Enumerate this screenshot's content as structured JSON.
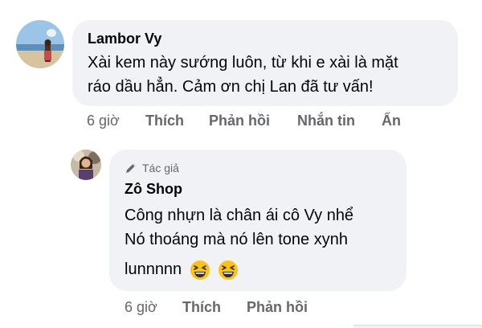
{
  "comment": {
    "author": "Lambor Vy",
    "text_lines": [
      "Xài kem này sướng luôn, từ khi e xài là mặt",
      "ráo dầu hẳn. Cảm ơn chị Lan đã tư vấn!"
    ],
    "time": "6 giờ",
    "actions": {
      "like": "Thích",
      "reply": "Phản hồi",
      "message": "Nhắn tin",
      "hide": "Ẩn"
    }
  },
  "reply": {
    "badge": "Tác giả",
    "author": "Zô Shop",
    "text_lines": [
      "Công nhựn là chân ái cô Vy nhể",
      "Nó  thoáng mà nó lên tone xynh",
      "lunnnnn"
    ],
    "emoji": [
      "grinning-squinting-face",
      "grinning-squinting-face"
    ],
    "time": "6 giờ",
    "actions": {
      "like": "Thích",
      "reply": "Phản hồi"
    }
  },
  "colors": {
    "bubble": "#f0f2f5",
    "meta_text": "#65676b",
    "text": "#050505"
  }
}
